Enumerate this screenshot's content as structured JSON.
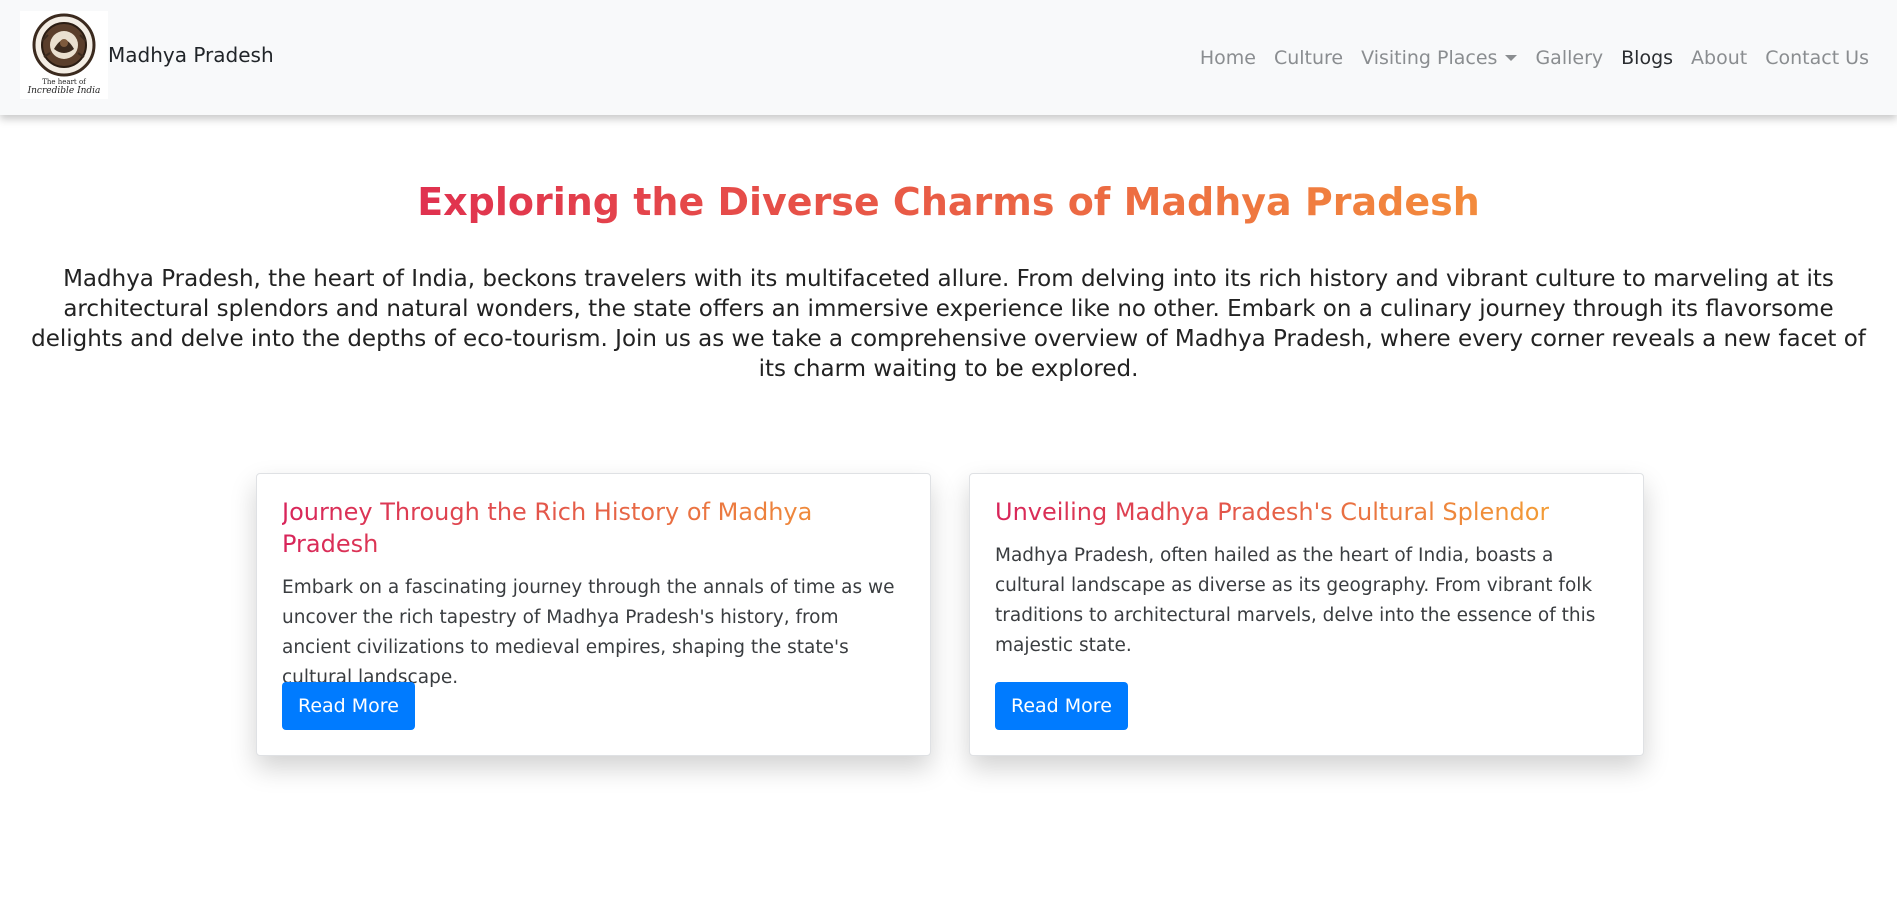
{
  "brand": {
    "name": "Madhya Pradesh",
    "logo_text_top": "MADHYA PRADESH",
    "logo_tagline_1": "The heart of",
    "logo_tagline_2": "Incredible India"
  },
  "nav": {
    "items": [
      {
        "label": "Home"
      },
      {
        "label": "Culture"
      },
      {
        "label": "Visiting Places"
      },
      {
        "label": "Gallery"
      },
      {
        "label": "Blogs"
      },
      {
        "label": "About"
      },
      {
        "label": "Contact Us"
      }
    ],
    "active": "Blogs"
  },
  "main": {
    "title": "Exploring the Diverse Charms of Madhya Pradesh",
    "intro": "Madhya Pradesh, the heart of India, beckons travelers with its multifaceted allure. From delving into its rich history and vibrant culture to marveling at its architectural splendors and natural wonders, the state offers an immersive experience like no other. Embark on a culinary journey through its flavorsome delights and delve into the depths of eco-tourism. Join us as we take a comprehensive overview of Madhya Pradesh, where every corner reveals a new facet of its charm waiting to be explored.",
    "cards": [
      {
        "title": "Journey Through the Rich History of Madhya Pradesh",
        "text": "Embark on a fascinating journey through the annals of time as we uncover the rich tapestry of Madhya Pradesh's history, from ancient civilizations to medieval empires, shaping the state's cultural landscape.",
        "button": "Read More"
      },
      {
        "title": "Unveiling Madhya Pradesh's Cultural Splendor",
        "text": "Madhya Pradesh, often hailed as the heart of India, boasts a cultural landscape as diverse as its geography. From vibrant folk traditions to architectural marvels, delve into the essence of this majestic state.",
        "button": "Read More"
      }
    ]
  },
  "colors": {
    "navbar_bg": "#f8f9fa",
    "button_bg": "#007bff",
    "title_gradient_start": "#e0314f",
    "title_gradient_end": "#f38b3c",
    "nav_link": "#8a8d90",
    "nav_link_active": "#2a2d30"
  }
}
